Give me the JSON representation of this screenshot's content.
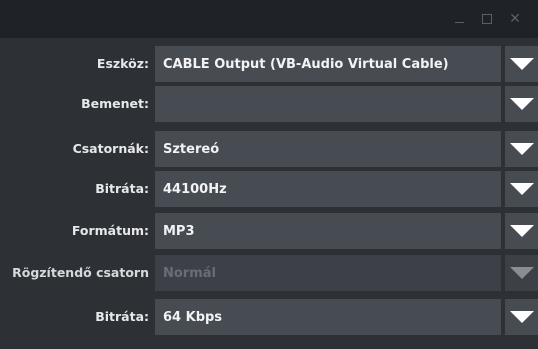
{
  "window": {
    "controls": {
      "minimize_icon": "minimize-icon",
      "maximize_icon": "maximize-icon",
      "close_icon": "close-icon",
      "close_glyph": "✕"
    }
  },
  "form": {
    "rows": [
      {
        "label": "Eszköz:",
        "value": "CABLE Output (VB-Audio Virtual Cable)",
        "enabled": true
      },
      {
        "label": "Bemenet:",
        "value": "",
        "enabled": true
      },
      {
        "label": "Csatornák:",
        "value": "Sztereó",
        "enabled": true
      },
      {
        "label": "Bitráta:",
        "value": "44100Hz",
        "enabled": true
      },
      {
        "label": "Formátum:",
        "value": "MP3",
        "enabled": true
      },
      {
        "label": "Rögzítendő csatorn",
        "value": "Normál",
        "enabled": false
      },
      {
        "label": "Bitráta:",
        "value": "64 Kbps",
        "enabled": true
      }
    ]
  },
  "colors": {
    "background": "#2d3034",
    "titlebar": "#1f2226",
    "field": "#474b52",
    "field_disabled": "#3d4046",
    "text": "#f2f3f5",
    "text_disabled": "#6a6e74"
  }
}
